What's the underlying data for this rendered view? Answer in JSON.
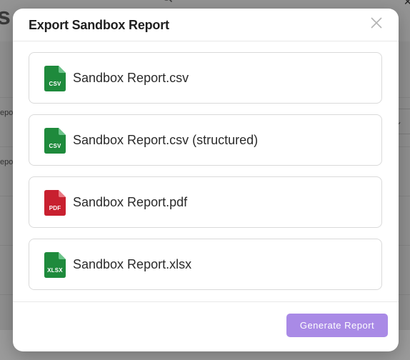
{
  "modal": {
    "title": "Export Sandbox Report",
    "close_icon": "close-icon",
    "options": [
      {
        "label": "Sandbox Report.csv",
        "ext": "CSV",
        "icon": "csv-file-icon",
        "color": "#1e8a3c"
      },
      {
        "label": "Sandbox Report.csv (structured)",
        "ext": "CSV",
        "icon": "csv-file-icon",
        "color": "#1e8a3c"
      },
      {
        "label": "Sandbox Report.pdf",
        "ext": "PDF",
        "icon": "pdf-file-icon",
        "color": "#c8202f"
      },
      {
        "label": "Sandbox Report.xlsx",
        "ext": "XLSX",
        "icon": "xlsx-file-icon",
        "color": "#1e8a3c"
      }
    ],
    "generate_label": "Generate Report"
  },
  "background": {
    "heading_fragment": "s",
    "row_fragments": [
      "epo",
      "epo"
    ],
    "search_icon": "search-icon",
    "chevron_icon": "chevron-down-icon"
  },
  "colors": {
    "accent": "#a98ae6",
    "csv_green": "#1e8a3c",
    "pdf_red": "#c8202f"
  }
}
